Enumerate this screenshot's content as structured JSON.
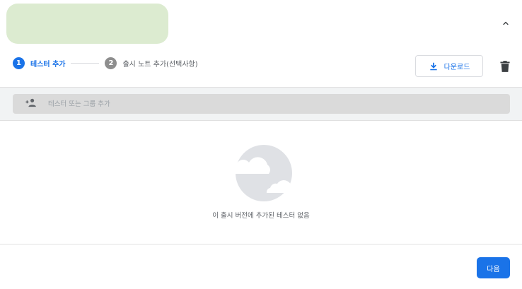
{
  "header": {
    "collapse_icon": "chevron-up-icon"
  },
  "stepper": {
    "steps": [
      {
        "number": "1",
        "label": "테스터 추가",
        "state": "active"
      },
      {
        "number": "2",
        "label": "출시 노트 추가(선택사항)",
        "state": "inactive"
      }
    ]
  },
  "toolbar": {
    "download_label": "다운로드",
    "download_icon": "download-icon",
    "delete_icon": "trash-icon"
  },
  "search": {
    "placeholder": "테스터 또는 그룹 추가",
    "value": "",
    "icon": "add-person-icon"
  },
  "empty_state": {
    "message": "이 출시 버전에 추가된 테스터 없음",
    "illustration": "cloud-illustration"
  },
  "footer": {
    "next_label": "다음"
  },
  "colors": {
    "accent": "#1a73e8",
    "header_block": "#dcebd0",
    "band": "#f1f3f4",
    "field": "#dadada",
    "inactive_step": "#8e8e8e"
  }
}
